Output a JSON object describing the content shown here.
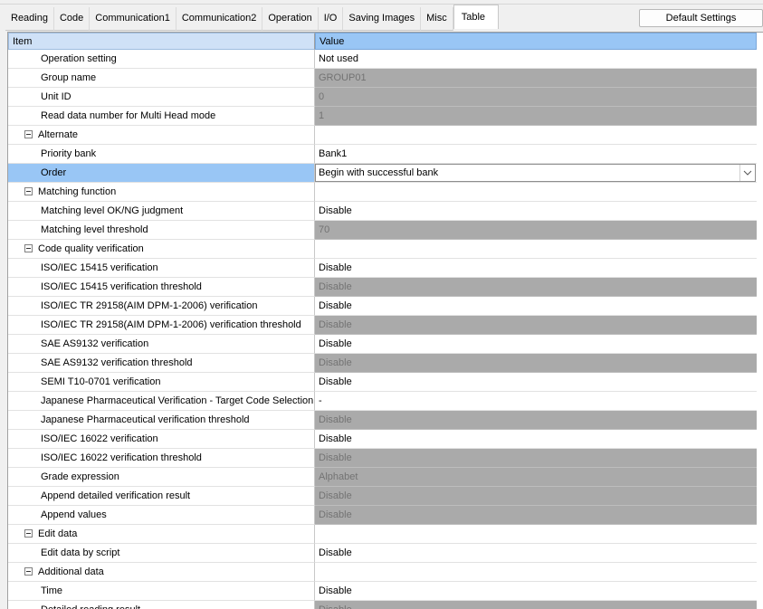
{
  "tabs": [
    "Reading",
    "Code",
    "Communication1",
    "Communication2",
    "Operation",
    "I/O",
    "Saving Images",
    "Misc",
    "Table"
  ],
  "active_tab": "Table",
  "default_button": "Default Settings",
  "table": {
    "header_item": "Item",
    "header_value": "Value",
    "rows": [
      {
        "name": "Operation setting",
        "value": "Not used",
        "state": "editable"
      },
      {
        "name": "Group name",
        "value": "GROUP01",
        "state": "disabled"
      },
      {
        "name": "Unit ID",
        "value": "0",
        "state": "disabled"
      },
      {
        "name": "Read data number for Multi Head mode",
        "value": "1",
        "state": "disabled"
      },
      {
        "name": "Alternate",
        "value": "",
        "state": "group"
      },
      {
        "name": "Priority bank",
        "value": "Bank1",
        "state": "editable"
      },
      {
        "name": "Order",
        "value": "Begin with successful bank",
        "state": "selected"
      },
      {
        "name": "Matching function",
        "value": "",
        "state": "group"
      },
      {
        "name": "Matching level OK/NG judgment",
        "value": "Disable",
        "state": "editable"
      },
      {
        "name": "Matching level threshold",
        "value": "70",
        "state": "disabled"
      },
      {
        "name": "Code quality verification",
        "value": "",
        "state": "group"
      },
      {
        "name": "ISO/IEC 15415 verification",
        "value": "Disable",
        "state": "editable"
      },
      {
        "name": "ISO/IEC 15415 verification threshold",
        "value": "Disable",
        "state": "disabled"
      },
      {
        "name": "ISO/IEC TR 29158(AIM DPM-1-2006) verification",
        "value": "Disable",
        "state": "editable"
      },
      {
        "name": "ISO/IEC TR 29158(AIM DPM-1-2006) verification threshold",
        "value": "Disable",
        "state": "disabled"
      },
      {
        "name": "SAE AS9132 verification",
        "value": "Disable",
        "state": "editable"
      },
      {
        "name": "SAE AS9132 verification threshold",
        "value": "Disable",
        "state": "disabled"
      },
      {
        "name": "SEMI T10-0701 verification",
        "value": "Disable",
        "state": "editable"
      },
      {
        "name": "Japanese Pharmaceutical Verification - Target Code Selection",
        "value": "-",
        "state": "editable"
      },
      {
        "name": "Japanese Pharmaceutical verification threshold",
        "value": "Disable",
        "state": "disabled"
      },
      {
        "name": "ISO/IEC 16022 verification",
        "value": "Disable",
        "state": "editable"
      },
      {
        "name": "ISO/IEC 16022 verification threshold",
        "value": "Disable",
        "state": "disabled"
      },
      {
        "name": "Grade expression",
        "value": "Alphabet",
        "state": "disabled"
      },
      {
        "name": "Append detailed verification result",
        "value": "Disable",
        "state": "disabled"
      },
      {
        "name": "Append values",
        "value": "Disable",
        "state": "disabled"
      },
      {
        "name": "Edit data",
        "value": "",
        "state": "group"
      },
      {
        "name": "Edit data by script",
        "value": "Disable",
        "state": "editable"
      },
      {
        "name": "Additional data",
        "value": "",
        "state": "group"
      },
      {
        "name": "Time",
        "value": "Disable",
        "state": "editable"
      },
      {
        "name": "Detailed reading result",
        "value": "Disable",
        "state": "disabled"
      }
    ]
  },
  "colors": {
    "selection": "#99c6f5",
    "disabled_bg": "#aaaaaa",
    "disabled_text": "#737373"
  }
}
